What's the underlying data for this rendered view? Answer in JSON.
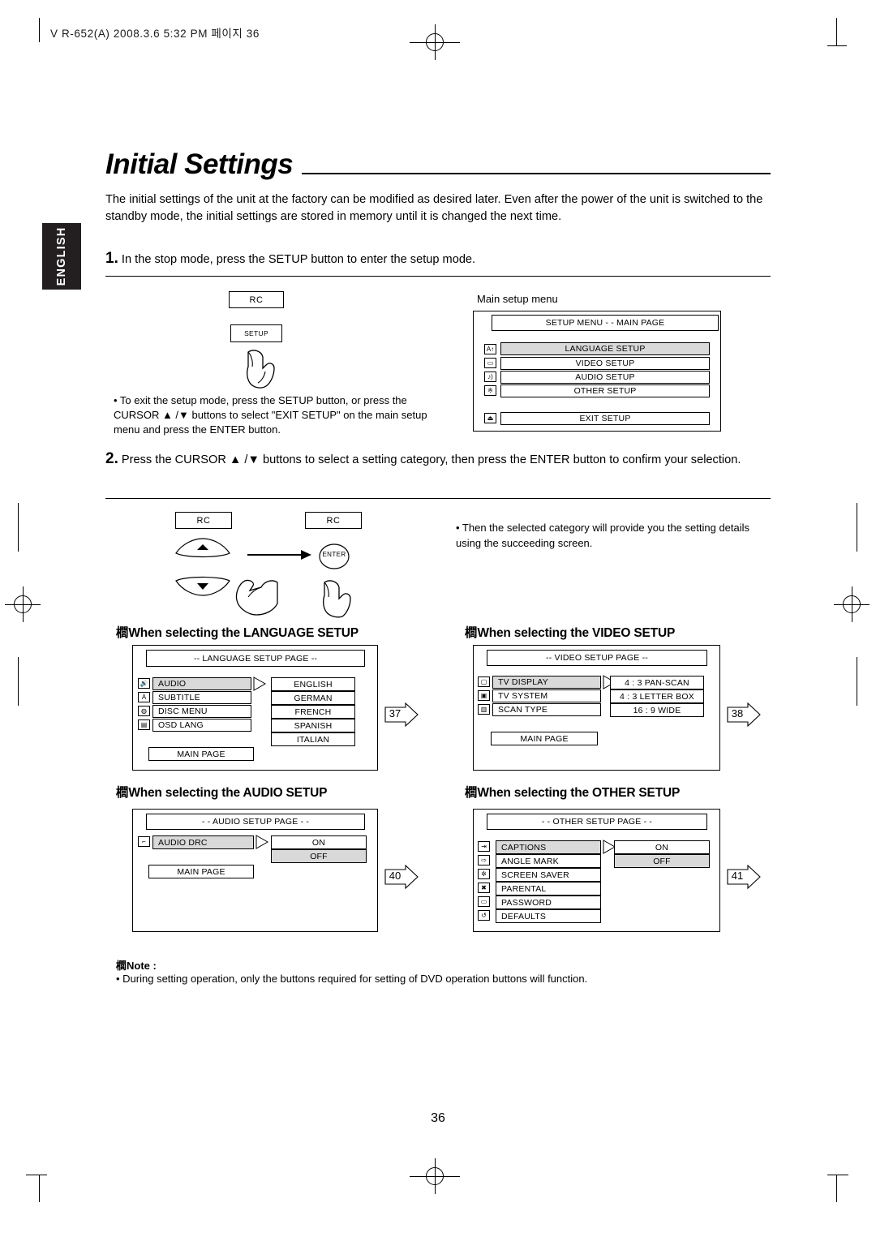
{
  "header": {
    "text": "V R-652(A)  2008.3.6  5:32 PM  페이지 36"
  },
  "side_tab": {
    "label": "ENGLISH"
  },
  "title": "Initial Settings",
  "intro": "The initial settings of the unit at the factory can be modified as desired later. Even after the power of the unit is switched to the standby mode, the initial settings are stored in memory until it is changed the next time.",
  "steps": [
    {
      "num": "1.",
      "text": "In the stop mode, press the SETUP button to enter the setup mode."
    },
    {
      "num": "2.",
      "text": "Press the CURSOR ▲ /▼  buttons to select a setting category, then press the ENTER button to confirm your selection."
    }
  ],
  "step1": {
    "rc_label": "RC",
    "setup_label": "SETUP",
    "bullet": "• To exit the setup mode, press the SETUP button, or press the CURSOR ▲ /▼  buttons to select \"EXIT SETUP\" on the main setup menu and press the ENTER button.",
    "main_setup_caption": "Main setup menu",
    "menu": {
      "title": "SETUP MENU - - MAIN PAGE",
      "items": [
        {
          "label": "LANGUAGE SETUP",
          "selected": true,
          "icon": "language-icon"
        },
        {
          "label": "VIDEO SETUP",
          "selected": false,
          "icon": "video-icon"
        },
        {
          "label": "AUDIO SETUP",
          "selected": false,
          "icon": "audio-icon"
        },
        {
          "label": "OTHER SETUP",
          "selected": false,
          "icon": "other-icon"
        }
      ],
      "exit": {
        "label": "EXIT SETUP",
        "icon": "exit-icon"
      }
    }
  },
  "step2": {
    "rc_label_left": "RC",
    "rc_label_right": "RC",
    "enter_label": "ENTER",
    "bullet": "• Then the selected category will provide you the setting details using the succeeding screen."
  },
  "sections": [
    {
      "heading": "When selecting the LANGUAGE SETUP",
      "window_title": "-- LANGUAGE  SETUP  PAGE --",
      "left_items": [
        {
          "label": "AUDIO",
          "selected": true,
          "icon": "speaker-icon"
        },
        {
          "label": "SUBTITLE",
          "selected": false,
          "icon": "subtitle-icon"
        },
        {
          "label": "DISC MENU",
          "selected": false,
          "icon": "disc-icon"
        },
        {
          "label": "OSD LANG",
          "selected": false,
          "icon": "osd-icon"
        }
      ],
      "main_page": "MAIN PAGE",
      "right_items": [
        "ENGLISH",
        "GERMAN",
        "FRENCH",
        "SPANISH",
        "ITALIAN"
      ],
      "page_ref": "37"
    },
    {
      "heading": "When selecting the VIDEO SETUP",
      "window_title": "-- VIDEO  SETUP  PAGE --",
      "left_items": [
        {
          "label": "TV DISPLAY",
          "selected": true,
          "icon": "tv-display-icon"
        },
        {
          "label": "TV SYSTEM",
          "selected": false,
          "icon": "tv-system-icon"
        },
        {
          "label": "SCAN TYPE",
          "selected": false,
          "icon": "scan-type-icon"
        }
      ],
      "main_page": "MAIN PAGE",
      "right_items": [
        "4 : 3 PAN-SCAN",
        "4 : 3 LETTER BOX",
        "16 : 9 WIDE"
      ],
      "page_ref": "38"
    },
    {
      "heading": "When selecting the AUDIO SETUP",
      "window_title": "- - AUDIO SETUP PAGE - -",
      "left_items": [
        {
          "label": "AUDIO DRC",
          "selected": true,
          "icon": "drc-icon"
        }
      ],
      "main_page": "MAIN PAGE",
      "right_items": [
        "ON",
        "OFF"
      ],
      "page_ref": "40"
    },
    {
      "heading": "When selecting the OTHER SETUP",
      "window_title": "- - OTHER SETUP PAGE - -",
      "left_items": [
        {
          "label": "CAPTIONS",
          "selected": true,
          "icon": "captions-icon"
        },
        {
          "label": "ANGLE MARK",
          "selected": false,
          "icon": "angle-mark-icon"
        },
        {
          "label": "SCREEN SAVER",
          "selected": false,
          "icon": "screen-saver-icon"
        },
        {
          "label": "PARENTAL",
          "selected": false,
          "icon": "parental-icon"
        },
        {
          "label": "PASSWORD",
          "selected": false,
          "icon": "password-icon"
        },
        {
          "label": "DEFAULTS",
          "selected": false,
          "icon": "defaults-icon"
        }
      ],
      "right_items": [
        "ON",
        "OFF"
      ],
      "page_ref": "41"
    }
  ],
  "note": {
    "title": "Note :",
    "text": "• During setting operation, only the buttons required for setting of DVD operation buttons will function."
  },
  "page_number": "36",
  "marker_glyph": "櫚"
}
